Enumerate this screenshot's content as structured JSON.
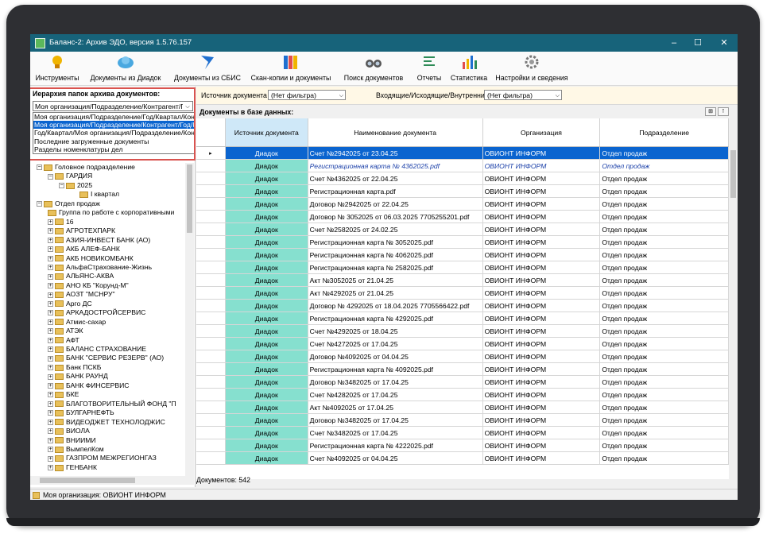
{
  "window": {
    "title": "Баланс-2: Архив ЭДО, версия 1.5.76.157",
    "minimize": "–",
    "maximize": "☐",
    "close": "✕"
  },
  "toolbar": [
    {
      "label": "Инструменты",
      "icon": "tools-icon"
    },
    {
      "label": "Документы из Диадок",
      "icon": "diadoc-cloud-icon"
    },
    {
      "label": "Документы из СБИС",
      "icon": "sbis-icon"
    },
    {
      "label": "Скан-копии и документы",
      "icon": "binders-icon"
    },
    {
      "label": "Поиск документов",
      "icon": "binoculars-icon"
    },
    {
      "label": "Отчеты",
      "icon": "report-icon"
    },
    {
      "label": "Статистика",
      "icon": "chart-icon"
    },
    {
      "label": "Настройки и сведения",
      "icon": "gear-icon"
    }
  ],
  "left": {
    "heading": "Иерархия папок архива документов:",
    "combo_value": "Моя организация/Подразделение/Контрагент/Год/Квартал",
    "options": [
      "Моя организация/Подразделение/Год/Квартал/Контрагент",
      "Моя организация/Подразделение/Контрагент/Год/Квартал",
      "Год/Квартал/Моя организация/Подразделение/Контрагент",
      "Последние загруженные документы",
      "Разделы номенклатуры дел"
    ],
    "tree": [
      {
        "label": "Головное подразделение",
        "level": 1,
        "pm": "−"
      },
      {
        "label": "ГАРДИЯ",
        "level": 2,
        "pm": "−"
      },
      {
        "label": "2025",
        "level": 3,
        "pm": "−"
      },
      {
        "label": "I квартал",
        "level": 4,
        "pm": ""
      },
      {
        "label": "Отдел продаж",
        "level": 1,
        "pm": "−"
      },
      {
        "label": "Группа по работе с корпоративными",
        "level": 2,
        "pm": ""
      },
      {
        "label": "16",
        "level": 2,
        "pm": "+"
      },
      {
        "label": "АГРОТЕХПАРК",
        "level": 2,
        "pm": "+"
      },
      {
        "label": "АЗИЯ-ИНВЕСТ БАНК (АО)",
        "level": 2,
        "pm": "+"
      },
      {
        "label": "АКБ АЛЕФ-БАНК",
        "level": 2,
        "pm": "+"
      },
      {
        "label": "АКБ НОВИКОМБАНК",
        "level": 2,
        "pm": "+"
      },
      {
        "label": "АльфаСтрахование-Жизнь",
        "level": 2,
        "pm": "+"
      },
      {
        "label": "АЛЬЯНС-АКВА",
        "level": 2,
        "pm": "+"
      },
      {
        "label": "АНО КБ \"Корунд-М\"",
        "level": 2,
        "pm": "+"
      },
      {
        "label": "АОЗТ \"МСНРУ\"",
        "level": 2,
        "pm": "+"
      },
      {
        "label": "Арго ДС",
        "level": 2,
        "pm": "+"
      },
      {
        "label": "АРКАДОСТРОЙСЕРВИС",
        "level": 2,
        "pm": "+"
      },
      {
        "label": "Атмис-сахар",
        "level": 2,
        "pm": "+"
      },
      {
        "label": "АТЭК",
        "level": 2,
        "pm": "+"
      },
      {
        "label": "АФТ",
        "level": 2,
        "pm": "+"
      },
      {
        "label": "БАЛАНС СТРАХОВАНИЕ",
        "level": 2,
        "pm": "+"
      },
      {
        "label": "БАНК \"СЕРВИС РЕЗЕРВ\" (АО)",
        "level": 2,
        "pm": "+"
      },
      {
        "label": "Банк ПСКБ",
        "level": 2,
        "pm": "+"
      },
      {
        "label": "БАНК РАУНД",
        "level": 2,
        "pm": "+"
      },
      {
        "label": "БАНК ФИНСЕРВИС",
        "level": 2,
        "pm": "+"
      },
      {
        "label": "БКЕ",
        "level": 2,
        "pm": "+"
      },
      {
        "label": "БЛАГОТВОРИТЕЛЬНЫЙ ФОНД \"П",
        "level": 2,
        "pm": "+"
      },
      {
        "label": "БУЛГАРНЕФТЬ",
        "level": 2,
        "pm": "+"
      },
      {
        "label": "ВИДЕОДЖЕТ ТЕХНОЛОДЖИС",
        "level": 2,
        "pm": "+"
      },
      {
        "label": "ВИОЛА",
        "level": 2,
        "pm": "+"
      },
      {
        "label": "ВНИИМИ",
        "level": 2,
        "pm": "+"
      },
      {
        "label": "ВымпелКом",
        "level": 2,
        "pm": "+"
      },
      {
        "label": "ГАЗПРОМ МЕЖРЕГИОНГАЗ",
        "level": 2,
        "pm": "+"
      },
      {
        "label": "ГЕНБАНК",
        "level": 2,
        "pm": "+"
      }
    ]
  },
  "filters": {
    "source_label": "Источник документа",
    "source_value": "(Нет фильтра)",
    "direction_label": "Входящие/Исходящие/Внутренние",
    "direction_value": "(Нет фильтра)"
  },
  "grid": {
    "title": "Документы в базе данных:",
    "columns": [
      "Источник документа",
      "Наименование документа",
      "Организация",
      "Подразделение"
    ],
    "rows": [
      {
        "src": "Диадок",
        "name": "Счет №2942025 от 23.04.25",
        "org": "ОВИОНТ ИНФОРМ",
        "dept": "Отдел продаж",
        "state": "selected"
      },
      {
        "src": "Диадок",
        "name": "Регистрационная карта № 4362025.pdf",
        "org": "ОВИОНТ ИНФОРМ",
        "dept": "Отдел продаж",
        "state": "italic"
      },
      {
        "src": "Диадок",
        "name": "Счет №4362025 от 22.04.25",
        "org": "ОВИОНТ ИНФОРМ",
        "dept": "Отдел продаж",
        "state": ""
      },
      {
        "src": "Диадок",
        "name": "Регистрационная карта.pdf",
        "org": "ОВИОНТ ИНФОРМ",
        "dept": "Отдел продаж",
        "state": ""
      },
      {
        "src": "Диадок",
        "name": "Договор №2942025  от 22.04.25",
        "org": "ОВИОНТ ИНФОРМ",
        "dept": "Отдел продаж",
        "state": ""
      },
      {
        "src": "Диадок",
        "name": "Договор № 3052025 от 06.03.2025 7705255201.pdf",
        "org": "ОВИОНТ ИНФОРМ",
        "dept": "Отдел продаж",
        "state": ""
      },
      {
        "src": "Диадок",
        "name": "Счет №2582025 от 24.02.25",
        "org": "ОВИОНТ ИНФОРМ",
        "dept": "Отдел продаж",
        "state": ""
      },
      {
        "src": "Диадок",
        "name": "Регистрационная карта № 3052025.pdf",
        "org": "ОВИОНТ ИНФОРМ",
        "dept": "Отдел продаж",
        "state": ""
      },
      {
        "src": "Диадок",
        "name": "Регистрационная карта № 4062025.pdf",
        "org": "ОВИОНТ ИНФОРМ",
        "dept": "Отдел продаж",
        "state": ""
      },
      {
        "src": "Диадок",
        "name": "Регистрационная карта № 2582025.pdf",
        "org": "ОВИОНТ ИНФОРМ",
        "dept": "Отдел продаж",
        "state": ""
      },
      {
        "src": "Диадок",
        "name": "Акт №3052025 от 21.04.25",
        "org": "ОВИОНТ ИНФОРМ",
        "dept": "Отдел продаж",
        "state": ""
      },
      {
        "src": "Диадок",
        "name": "Акт №4292025 от 21.04.25",
        "org": "ОВИОНТ ИНФОРМ",
        "dept": "Отдел продаж",
        "state": ""
      },
      {
        "src": "Диадок",
        "name": "Договор № 4292025 от 18.04.2025 7705566422.pdf",
        "org": "ОВИОНТ ИНФОРМ",
        "dept": "Отдел продаж",
        "state": ""
      },
      {
        "src": "Диадок",
        "name": "Регистрационная карта № 4292025.pdf",
        "org": "ОВИОНТ ИНФОРМ",
        "dept": "Отдел продаж",
        "state": ""
      },
      {
        "src": "Диадок",
        "name": "Счет №4292025 от 18.04.25",
        "org": "ОВИОНТ ИНФОРМ",
        "dept": "Отдел продаж",
        "state": ""
      },
      {
        "src": "Диадок",
        "name": "Счет №4272025 от 17.04.25",
        "org": "ОВИОНТ ИНФОРМ",
        "dept": "Отдел продаж",
        "state": ""
      },
      {
        "src": "Диадок",
        "name": "Договор №4092025 от 04.04.25",
        "org": "ОВИОНТ ИНФОРМ",
        "dept": "Отдел продаж",
        "state": ""
      },
      {
        "src": "Диадок",
        "name": "Регистрационная карта № 4092025.pdf",
        "org": "ОВИОНТ ИНФОРМ",
        "dept": "Отдел продаж",
        "state": ""
      },
      {
        "src": "Диадок",
        "name": "Договор №3482025 от 17.04.25",
        "org": "ОВИОНТ ИНФОРМ",
        "dept": "Отдел продаж",
        "state": ""
      },
      {
        "src": "Диадок",
        "name": "Счет №4282025 от 17.04.25",
        "org": "ОВИОНТ ИНФОРМ",
        "dept": "Отдел продаж",
        "state": ""
      },
      {
        "src": "Диадок",
        "name": "Акт №4092025 от 17.04.25",
        "org": "ОВИОНТ ИНФОРМ",
        "dept": "Отдел продаж",
        "state": ""
      },
      {
        "src": "Диадок",
        "name": "Договор №3482025 от 17.04.25",
        "org": "ОВИОНТ ИНФОРМ",
        "dept": "Отдел продаж",
        "state": ""
      },
      {
        "src": "Диадок",
        "name": "Счет №3482025 от 17.04.25",
        "org": "ОВИОНТ ИНФОРМ",
        "dept": "Отдел продаж",
        "state": ""
      },
      {
        "src": "Диадок",
        "name": "Регистрационная карта № 4222025.pdf",
        "org": "ОВИОНТ ИНФОРМ",
        "dept": "Отдел продаж",
        "state": ""
      },
      {
        "src": "Диадок",
        "name": "Счет №4092025 от 04.04.25",
        "org": "ОВИОНТ ИНФОРМ",
        "dept": "Отдел продаж",
        "state": ""
      }
    ],
    "count_text": "Документов: 542"
  },
  "status": {
    "text": "Моя организация: ОВИОНТ ИНФОРМ"
  }
}
